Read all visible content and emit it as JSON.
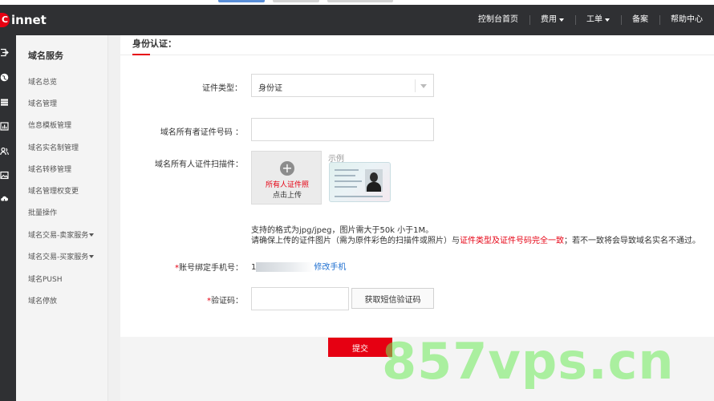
{
  "header": {
    "logo_text": "innet",
    "logo_mark": "C",
    "nav": [
      {
        "label": "控制台首页",
        "has_caret": false
      },
      {
        "label": "费用",
        "has_caret": true
      },
      {
        "label": "工单",
        "has_caret": true
      },
      {
        "label": "备案",
        "has_caret": false
      },
      {
        "label": "帮助中心",
        "has_caret": false
      }
    ]
  },
  "rail": {
    "icons": [
      "sign-in-icon",
      "globe-icon",
      "server-icon",
      "chart-icon",
      "users-icon",
      "image-icon",
      "cloud-icon"
    ]
  },
  "sidebar": {
    "title": "域名服务",
    "items": [
      {
        "label": "域名总览",
        "has_caret": false
      },
      {
        "label": "域名管理",
        "has_caret": false
      },
      {
        "label": "信息模板管理",
        "has_caret": false
      },
      {
        "label": "域名实名制管理",
        "has_caret": false
      },
      {
        "label": "域名转移管理",
        "has_caret": false
      },
      {
        "label": "域名管理权变更",
        "has_caret": false
      },
      {
        "label": "批量操作",
        "has_caret": false
      },
      {
        "label": "域名交易-卖家服务",
        "has_caret": true
      },
      {
        "label": "域名交易-买家服务",
        "has_caret": true
      },
      {
        "label": "域名PUSH",
        "has_caret": false
      },
      {
        "label": "域名停放",
        "has_caret": false
      }
    ]
  },
  "form": {
    "section_title": "身份认证：",
    "id_type": {
      "label": "证件类型：",
      "value": "身份证"
    },
    "id_number": {
      "label": "域名所有者证件号码 ：",
      "value": ""
    },
    "scan": {
      "label": "域名所有人证件扫描件：",
      "upload_line1": "所有人证件照",
      "upload_line2": "点击上传",
      "plus": "+",
      "example_label": "示例"
    },
    "hint": {
      "line1": "支持的格式为jpg/jpeg，图片需大于50k 小于1M。",
      "line2_prefix": "请确保上传的证件图片（需为原件彩色的扫描件或照片）与",
      "line2_red": "证件类型及证件号码完全一致",
      "line2_suffix": "；若不一致将会导致域名实名不通过。"
    },
    "phone": {
      "required_mark": "*",
      "label": "账号绑定手机号：",
      "value_visible": "1",
      "change_link": "修改手机"
    },
    "code": {
      "required_mark": "*",
      "label": "验证码：",
      "value": "",
      "sms_button": "获取短信验证码"
    },
    "submit": "提交"
  },
  "watermark": "857vps.cn",
  "colors": {
    "accent": "#e60012",
    "header_bg": "#2f3033",
    "link": "#1e6fd0",
    "watermark": "#6eeb5a"
  }
}
